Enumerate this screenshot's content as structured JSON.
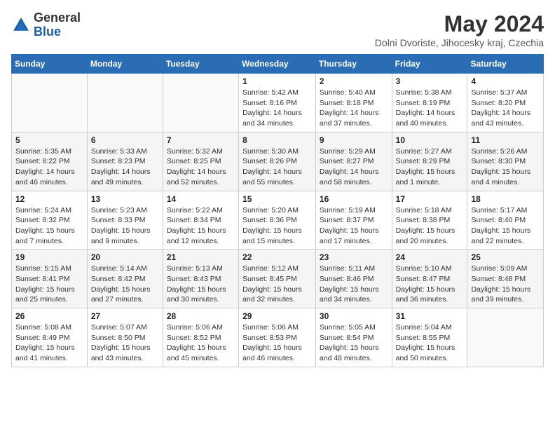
{
  "header": {
    "logo_general": "General",
    "logo_blue": "Blue",
    "month_year": "May 2024",
    "location": "Dolni Dvoriste, Jihocesky kraj, Czechia"
  },
  "days_of_week": [
    "Sunday",
    "Monday",
    "Tuesday",
    "Wednesday",
    "Thursday",
    "Friday",
    "Saturday"
  ],
  "weeks": [
    [
      {
        "day": "",
        "info": ""
      },
      {
        "day": "",
        "info": ""
      },
      {
        "day": "",
        "info": ""
      },
      {
        "day": "1",
        "info": "Sunrise: 5:42 AM\nSunset: 8:16 PM\nDaylight: 14 hours\nand 34 minutes."
      },
      {
        "day": "2",
        "info": "Sunrise: 5:40 AM\nSunset: 8:18 PM\nDaylight: 14 hours\nand 37 minutes."
      },
      {
        "day": "3",
        "info": "Sunrise: 5:38 AM\nSunset: 8:19 PM\nDaylight: 14 hours\nand 40 minutes."
      },
      {
        "day": "4",
        "info": "Sunrise: 5:37 AM\nSunset: 8:20 PM\nDaylight: 14 hours\nand 43 minutes."
      }
    ],
    [
      {
        "day": "5",
        "info": "Sunrise: 5:35 AM\nSunset: 8:22 PM\nDaylight: 14 hours\nand 46 minutes."
      },
      {
        "day": "6",
        "info": "Sunrise: 5:33 AM\nSunset: 8:23 PM\nDaylight: 14 hours\nand 49 minutes."
      },
      {
        "day": "7",
        "info": "Sunrise: 5:32 AM\nSunset: 8:25 PM\nDaylight: 14 hours\nand 52 minutes."
      },
      {
        "day": "8",
        "info": "Sunrise: 5:30 AM\nSunset: 8:26 PM\nDaylight: 14 hours\nand 55 minutes."
      },
      {
        "day": "9",
        "info": "Sunrise: 5:29 AM\nSunset: 8:27 PM\nDaylight: 14 hours\nand 58 minutes."
      },
      {
        "day": "10",
        "info": "Sunrise: 5:27 AM\nSunset: 8:29 PM\nDaylight: 15 hours\nand 1 minute."
      },
      {
        "day": "11",
        "info": "Sunrise: 5:26 AM\nSunset: 8:30 PM\nDaylight: 15 hours\nand 4 minutes."
      }
    ],
    [
      {
        "day": "12",
        "info": "Sunrise: 5:24 AM\nSunset: 8:32 PM\nDaylight: 15 hours\nand 7 minutes."
      },
      {
        "day": "13",
        "info": "Sunrise: 5:23 AM\nSunset: 8:33 PM\nDaylight: 15 hours\nand 9 minutes."
      },
      {
        "day": "14",
        "info": "Sunrise: 5:22 AM\nSunset: 8:34 PM\nDaylight: 15 hours\nand 12 minutes."
      },
      {
        "day": "15",
        "info": "Sunrise: 5:20 AM\nSunset: 8:36 PM\nDaylight: 15 hours\nand 15 minutes."
      },
      {
        "day": "16",
        "info": "Sunrise: 5:19 AM\nSunset: 8:37 PM\nDaylight: 15 hours\nand 17 minutes."
      },
      {
        "day": "17",
        "info": "Sunrise: 5:18 AM\nSunset: 8:38 PM\nDaylight: 15 hours\nand 20 minutes."
      },
      {
        "day": "18",
        "info": "Sunrise: 5:17 AM\nSunset: 8:40 PM\nDaylight: 15 hours\nand 22 minutes."
      }
    ],
    [
      {
        "day": "19",
        "info": "Sunrise: 5:15 AM\nSunset: 8:41 PM\nDaylight: 15 hours\nand 25 minutes."
      },
      {
        "day": "20",
        "info": "Sunrise: 5:14 AM\nSunset: 8:42 PM\nDaylight: 15 hours\nand 27 minutes."
      },
      {
        "day": "21",
        "info": "Sunrise: 5:13 AM\nSunset: 8:43 PM\nDaylight: 15 hours\nand 30 minutes."
      },
      {
        "day": "22",
        "info": "Sunrise: 5:12 AM\nSunset: 8:45 PM\nDaylight: 15 hours\nand 32 minutes."
      },
      {
        "day": "23",
        "info": "Sunrise: 5:11 AM\nSunset: 8:46 PM\nDaylight: 15 hours\nand 34 minutes."
      },
      {
        "day": "24",
        "info": "Sunrise: 5:10 AM\nSunset: 8:47 PM\nDaylight: 15 hours\nand 36 minutes."
      },
      {
        "day": "25",
        "info": "Sunrise: 5:09 AM\nSunset: 8:48 PM\nDaylight: 15 hours\nand 39 minutes."
      }
    ],
    [
      {
        "day": "26",
        "info": "Sunrise: 5:08 AM\nSunset: 8:49 PM\nDaylight: 15 hours\nand 41 minutes."
      },
      {
        "day": "27",
        "info": "Sunrise: 5:07 AM\nSunset: 8:50 PM\nDaylight: 15 hours\nand 43 minutes."
      },
      {
        "day": "28",
        "info": "Sunrise: 5:06 AM\nSunset: 8:52 PM\nDaylight: 15 hours\nand 45 minutes."
      },
      {
        "day": "29",
        "info": "Sunrise: 5:06 AM\nSunset: 8:53 PM\nDaylight: 15 hours\nand 46 minutes."
      },
      {
        "day": "30",
        "info": "Sunrise: 5:05 AM\nSunset: 8:54 PM\nDaylight: 15 hours\nand 48 minutes."
      },
      {
        "day": "31",
        "info": "Sunrise: 5:04 AM\nSunset: 8:55 PM\nDaylight: 15 hours\nand 50 minutes."
      },
      {
        "day": "",
        "info": ""
      }
    ]
  ]
}
